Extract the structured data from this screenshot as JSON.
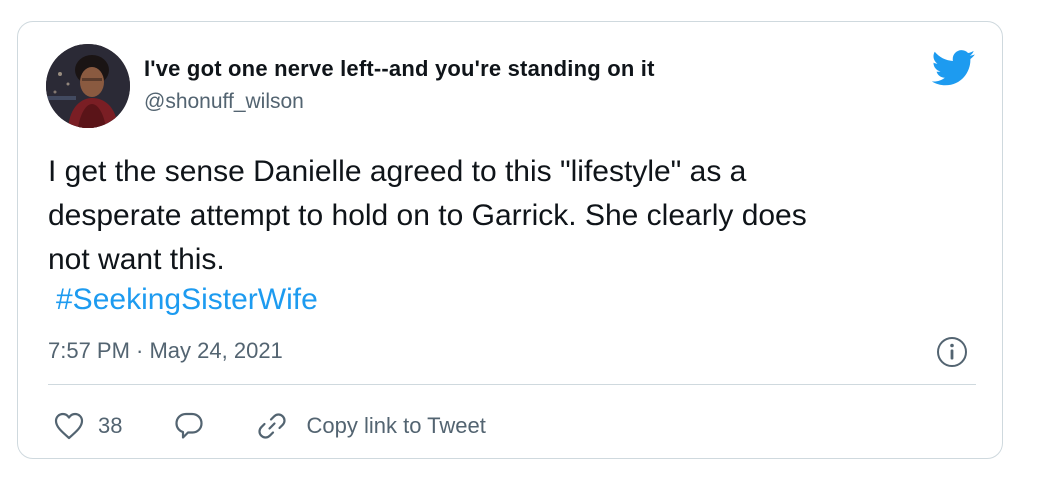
{
  "user": {
    "display_name": "I've got one nerve left--and you're standing on it",
    "handle": "@shonuff_wilson",
    "avatar_icon": "profile-photo"
  },
  "tweet": {
    "text": "I get the sense Danielle agreed to this \"lifestyle\" as a\ndesperate attempt to hold on to Garrick.  She clearly does\nnot want this.",
    "hashtag": "#SeekingSisterWife",
    "timestamp": "7:57 PM · May 24, 2021"
  },
  "actions": {
    "like_count": "38",
    "copy_link_label": "Copy link to Tweet"
  },
  "icons": {
    "brand": "twitter-bird-icon",
    "info": "info-icon",
    "like": "heart-icon",
    "reply": "reply-bubble-icon",
    "link": "link-icon"
  },
  "colors": {
    "accent": "#1d9bf0",
    "secondary_text": "#536471",
    "border": "#cfd9de"
  }
}
